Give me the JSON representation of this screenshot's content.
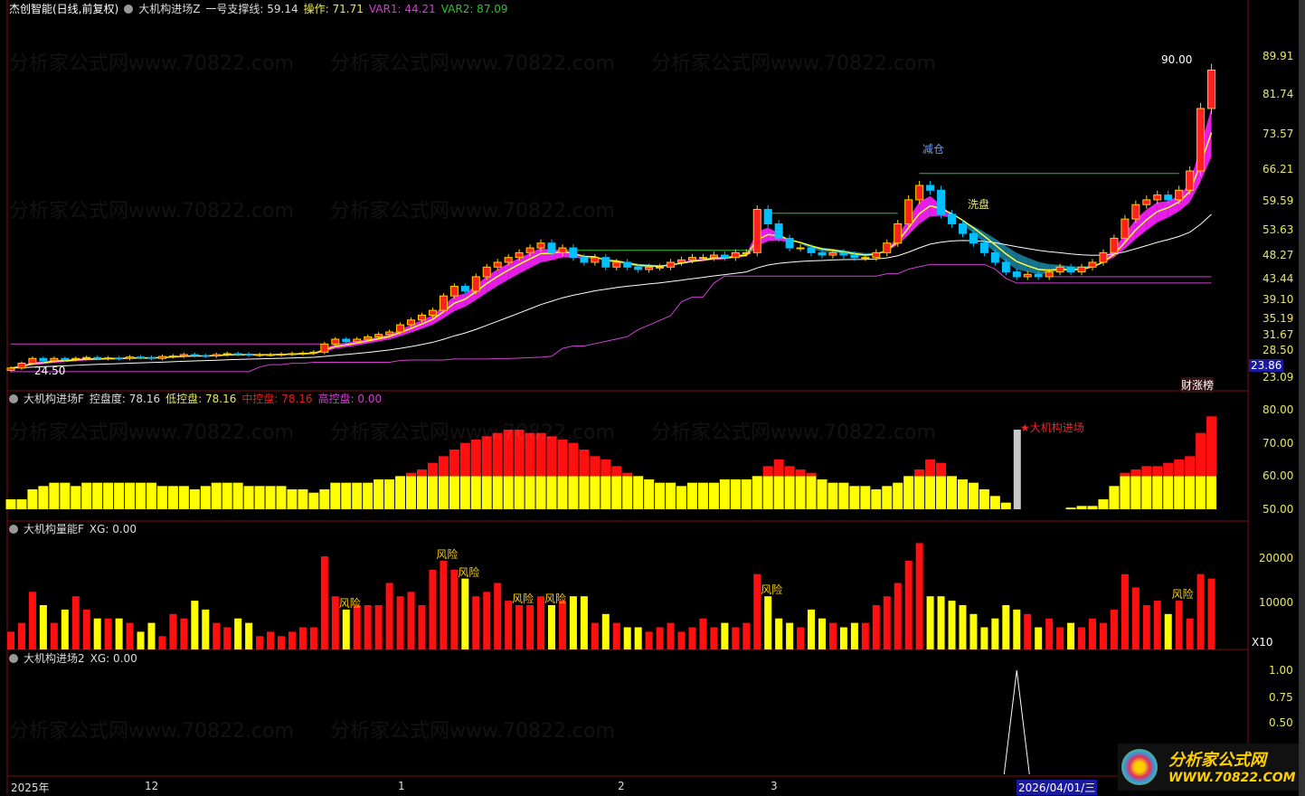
{
  "header": {
    "stock": "杰创智能(日线,前复权)",
    "indicator": "大机构进场Z",
    "support_label": "一号支撑线: 59.14",
    "op_label": "操作: 71.71",
    "var1_label": "VAR1: 44.21",
    "var2_label": "VAR2: 87.09"
  },
  "panel2": {
    "title": "大机构进场F",
    "ctrl": "控盘度: 78.16",
    "low": "低控盘: 78.16",
    "mid": "中控盘: 78.16",
    "high": "高控盘: 0.00"
  },
  "panel3": {
    "title": "大机构量能F",
    "xg": "XG: 0.00",
    "scale": "X10"
  },
  "panel4": {
    "title": "大机构进场2",
    "xg": "XG: 0.00"
  },
  "annotations": {
    "high_price": "90.00",
    "low_price": "24.50",
    "reduce": "减仓",
    "wash": "洗盘",
    "rank": "财涨榜",
    "entry": "★大机构进场",
    "risk": "风险"
  },
  "price_axis": [
    "89.91",
    "81.74",
    "73.57",
    "66.21",
    "59.59",
    "53.63",
    "48.27",
    "43.44",
    "39.10",
    "35.19",
    "31.67",
    "28.50",
    "23.09"
  ],
  "cursor_price": "23.86",
  "ind_axis": [
    "80.00",
    "70.00",
    "60.00",
    "50.00"
  ],
  "vol_axis": [
    "20000",
    "10000"
  ],
  "sig_axis": [
    "1.00",
    "0.75",
    "0.50"
  ],
  "dates": {
    "year": "2025年",
    "m12": "12",
    "m1": "1",
    "m2": "2",
    "m3": "3",
    "cursor": "2026/04/01/三"
  },
  "watermark": "分析家公式网www.70822.com",
  "logo": {
    "name": "分析家公式网",
    "url": "WWW.70822.COM"
  },
  "colors": {
    "up": "#ff2020",
    "down": "#00c0ff",
    "ma": "#ffffff",
    "support": "#d040d0",
    "level": "#30c030",
    "ribbon": "#ff20ff"
  },
  "chart_data": {
    "type": "candlestick",
    "close": [
      25,
      26,
      27,
      26.5,
      27,
      26.8,
      27,
      27.2,
      27,
      27.1,
      27,
      27.3,
      27.2,
      27,
      27.4,
      27.5,
      27.8,
      27.6,
      27.5,
      27.8,
      28,
      27.9,
      27.7,
      27.8,
      27.8,
      27.9,
      28,
      28.1,
      28.3,
      30,
      31,
      30.5,
      31,
      31.5,
      32,
      32.5,
      34,
      35,
      36,
      37,
      40,
      42,
      41,
      44,
      46,
      47,
      48,
      49,
      50,
      51,
      49,
      50,
      48,
      47,
      48,
      46,
      47,
      46,
      45.5,
      46,
      46,
      47,
      47.5,
      48,
      48,
      48.5,
      48,
      49,
      49,
      58,
      55,
      52,
      50,
      50,
      49,
      48.5,
      49,
      48.5,
      48,
      48,
      49,
      51,
      55,
      60,
      63,
      62,
      57,
      55,
      53,
      51,
      49,
      47,
      45,
      44,
      44.5,
      44,
      45,
      46,
      45,
      46,
      47,
      49,
      52,
      56,
      59,
      60,
      61,
      60,
      62,
      66,
      79,
      87
    ],
    "levels": [
      {
        "price": 30,
        "from": 0,
        "to": 29
      },
      {
        "price": 49.5,
        "from": 51,
        "to": 69
      },
      {
        "price": 57.2,
        "from": 70,
        "to": 82
      },
      {
        "price": 65.5,
        "from": 84,
        "to": 108
      },
      {
        "price": 44,
        "from": 96,
        "to": 111
      }
    ],
    "control": [
      53,
      53,
      56,
      57,
      58,
      58,
      57,
      58,
      58,
      58,
      58,
      58,
      58,
      58,
      57,
      57,
      57,
      56,
      57,
      58,
      58,
      58,
      57,
      57,
      57,
      57,
      56,
      56,
      55,
      56,
      58,
      58,
      58,
      58,
      59,
      59,
      60,
      61,
      62,
      64,
      66,
      68,
      70,
      71,
      72,
      73,
      74,
      74,
      73,
      73,
      72,
      71,
      70,
      68,
      66,
      65,
      63,
      61,
      60,
      59,
      58,
      58,
      57,
      58,
      58,
      58,
      59,
      59,
      59,
      60,
      63,
      65,
      63,
      62,
      61,
      59,
      58,
      58,
      57,
      57,
      56,
      57,
      58,
      60,
      62,
      65,
      64,
      60,
      59,
      58,
      56,
      54,
      52,
      74,
      50,
      50,
      50,
      50,
      50.5,
      51,
      51,
      53,
      57,
      61,
      62,
      63,
      63,
      64,
      65,
      66,
      73,
      78
    ],
    "volume_k": [
      4,
      6,
      13,
      10,
      6,
      9,
      12,
      9,
      7,
      7,
      7,
      6,
      4,
      6,
      3,
      8,
      7,
      11,
      9,
      6,
      5,
      7,
      6,
      3,
      4,
      3,
      4,
      5,
      5,
      21,
      12,
      9,
      10,
      10,
      10,
      15,
      12,
      13,
      10,
      18,
      20,
      18,
      16,
      12,
      13,
      15,
      11,
      10,
      10,
      12,
      10,
      11,
      12,
      12,
      6,
      8,
      6,
      5,
      5,
      4,
      5,
      6,
      4,
      5,
      7,
      5,
      6,
      5,
      6,
      17,
      12,
      7,
      6,
      5,
      9,
      7,
      6,
      5,
      6,
      6,
      10,
      12,
      15,
      20,
      24,
      12,
      12,
      11,
      10,
      8,
      5,
      7,
      10,
      9,
      8,
      5,
      7,
      5,
      6,
      5,
      7,
      6,
      9,
      17,
      14,
      10,
      11,
      8,
      11,
      7,
      17,
      16
    ],
    "risk_bars": [
      31,
      40,
      42,
      47,
      50,
      70,
      108
    ],
    "signal": {
      "bar": 93,
      "value": 1
    }
  }
}
